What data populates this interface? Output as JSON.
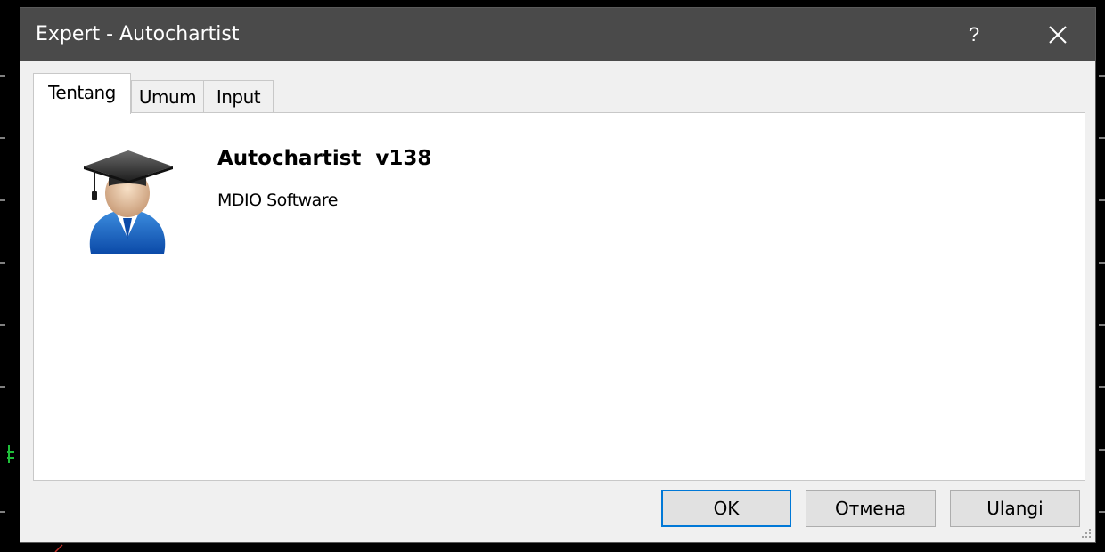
{
  "window": {
    "title": "Expert - Autochartist",
    "help_label": "?",
    "close_icon": "close-icon"
  },
  "tabs": [
    {
      "label": "Tentang",
      "active": true
    },
    {
      "label": "Umum",
      "active": false
    },
    {
      "label": "Input",
      "active": false
    }
  ],
  "about": {
    "name": "Autochartist  v138",
    "company": "MDIO Software",
    "avatar_icon": "graduate-avatar-icon"
  },
  "buttons": {
    "ok": "OK",
    "cancel": "Отмена",
    "reset": "Ulangi"
  },
  "colors": {
    "titlebar": "#4a4a4a",
    "accent": "#0078d7",
    "background": "#000000"
  }
}
